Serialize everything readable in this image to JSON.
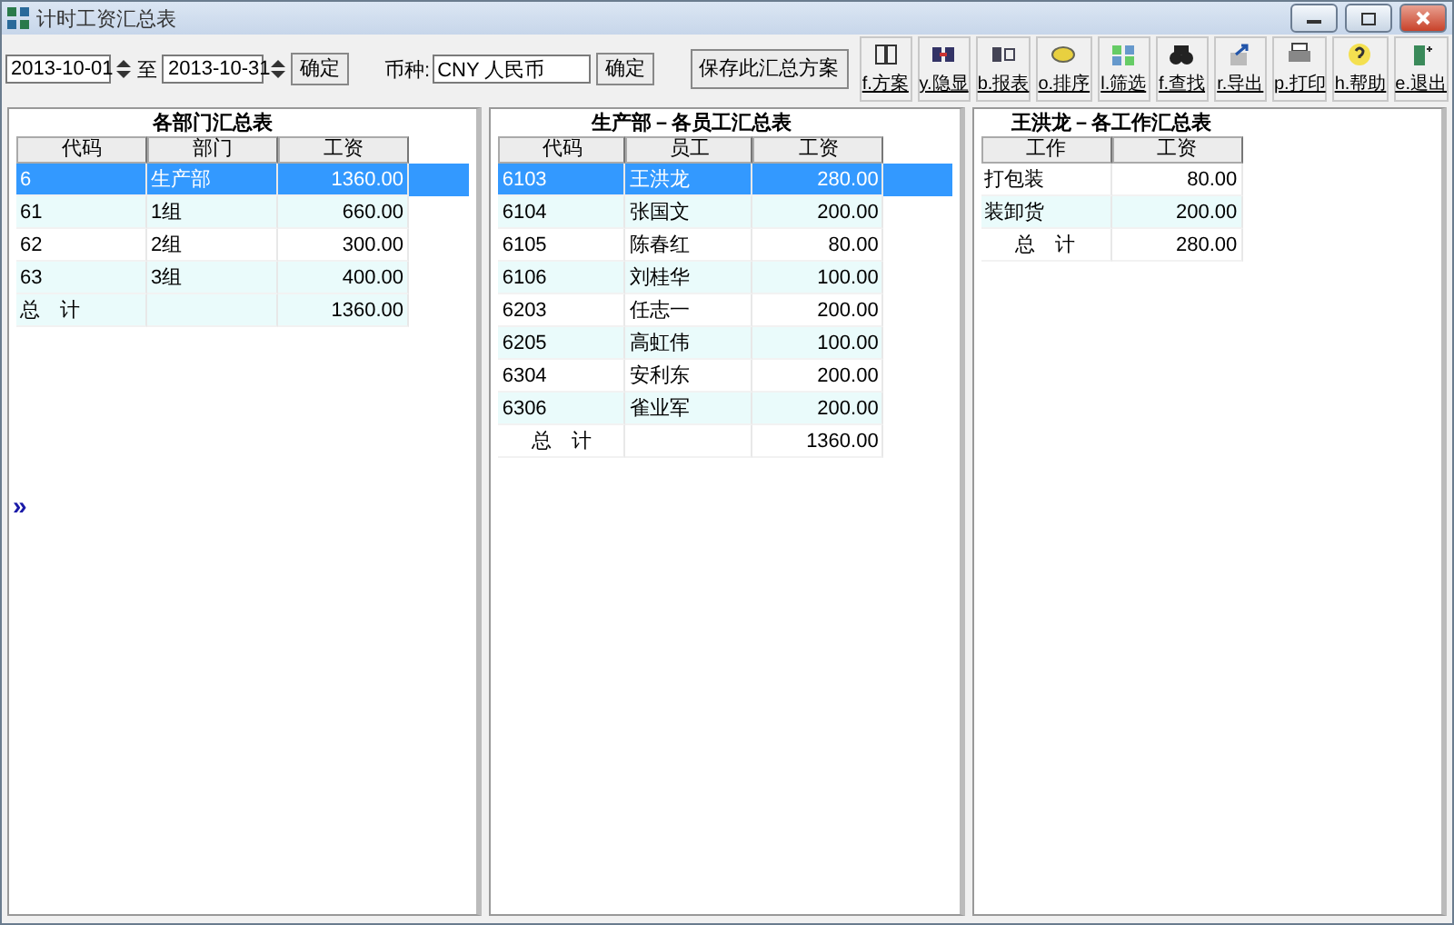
{
  "window": {
    "title": "计时工资汇总表"
  },
  "filter": {
    "date_from": "2013-10-01",
    "to_label": "至",
    "date_to": "2013-10-31",
    "confirm": "确定",
    "currency_label": "币种:",
    "currency": "CNY 人民币",
    "currency_confirm": "确定",
    "save": "保存此汇总方案"
  },
  "toolbar": [
    {
      "label": "f.方案"
    },
    {
      "label": "y.隐显"
    },
    {
      "label": "b.报表"
    },
    {
      "label": "o.排序"
    },
    {
      "label": "l.筛选"
    },
    {
      "label": "f.查找"
    },
    {
      "label": "r.导出"
    },
    {
      "label": "p.打印"
    },
    {
      "label": "h.帮助"
    },
    {
      "label": "e.退出"
    }
  ],
  "expander": "»",
  "tables": [
    {
      "title": "各部门汇总表",
      "columns": [
        "代码",
        "部门",
        "工资"
      ],
      "rows": [
        {
          "kind": "data",
          "selected": true,
          "cells": [
            "6",
            "生产部",
            "1360.00"
          ]
        },
        {
          "kind": "data",
          "selected": false,
          "cells": [
            "61",
            "1组",
            "660.00"
          ]
        },
        {
          "kind": "data",
          "selected": false,
          "cells": [
            "62",
            "2组",
            "300.00"
          ]
        },
        {
          "kind": "data",
          "selected": false,
          "cells": [
            "63",
            "3组",
            "400.00"
          ]
        },
        {
          "kind": "total",
          "selected": false,
          "cells": [
            "总　计",
            "",
            "1360.00"
          ]
        }
      ]
    },
    {
      "title": "生产部－各员工汇总表",
      "columns": [
        "代码",
        "员工",
        "工资"
      ],
      "rows": [
        {
          "kind": "data",
          "selected": true,
          "cells": [
            "6103",
            "王洪龙",
            "280.00"
          ]
        },
        {
          "kind": "data",
          "selected": false,
          "cells": [
            "6104",
            "张国文",
            "200.00"
          ]
        },
        {
          "kind": "data",
          "selected": false,
          "cells": [
            "6105",
            "陈春红",
            "80.00"
          ]
        },
        {
          "kind": "data",
          "selected": false,
          "cells": [
            "6106",
            "刘桂华",
            "100.00"
          ]
        },
        {
          "kind": "data",
          "selected": false,
          "cells": [
            "6203",
            "任志一",
            "200.00"
          ]
        },
        {
          "kind": "data",
          "selected": false,
          "cells": [
            "6205",
            "高虹伟",
            "100.00"
          ]
        },
        {
          "kind": "data",
          "selected": false,
          "cells": [
            "6304",
            "安利东",
            "200.00"
          ]
        },
        {
          "kind": "data",
          "selected": false,
          "cells": [
            "6306",
            "雀业军",
            "200.00"
          ]
        },
        {
          "kind": "total",
          "selected": false,
          "cells": [
            "总　计",
            "",
            "1360.00"
          ]
        }
      ]
    },
    {
      "title": "王洪龙－各工作汇总表",
      "columns": [
        "工作",
        "工资"
      ],
      "rows": [
        {
          "kind": "data",
          "selected": false,
          "cells": [
            "打包装",
            "80.00"
          ]
        },
        {
          "kind": "data",
          "selected": false,
          "cells": [
            "装卸货",
            "200.00"
          ]
        },
        {
          "kind": "total",
          "selected": false,
          "cells": [
            "总　计",
            "280.00"
          ]
        }
      ]
    }
  ]
}
